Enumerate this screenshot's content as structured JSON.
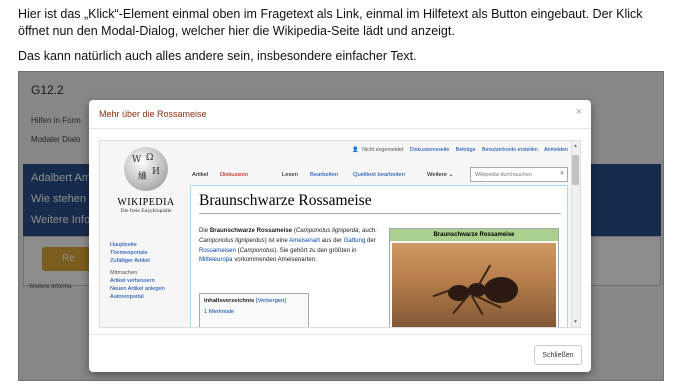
{
  "intro": {
    "line1": "Hier ist das „Klick“-Element einmal oben im Fragetext als Link, einmal im Hilfetext als Button eingebaut. Der Klick öffnet nun den Modal-Dialog, welcher hier die Wikipedia-Seite lädt und anzeigt.",
    "line2": "Das kann natürlich auch alles andere sein, insbesondere einfacher Text."
  },
  "background": {
    "question_number": "G12.2",
    "hint_line1": "Hilfen in Form",
    "hint_line2": "Modaler Dialo",
    "blue_line1": "Adalbert Am",
    "blue_line2": "Wie stehen S",
    "blue_line3": "Weitere Info",
    "button_label": "Re",
    "footer": "Weitere Informa"
  },
  "modal": {
    "title": "Mehr über die Rossameise",
    "close_symbol": "×",
    "close_button": "Schließen"
  },
  "wiki": {
    "wordmark": "WIKIPEDIA",
    "tagline": "Die freie Enzyklopädie",
    "personal": {
      "not_logged_in": "Nicht angemeldet",
      "talk": "Diskussionsseite",
      "contributions": "Beiträge",
      "create_account": "Benutzerkonto erstellen",
      "login": "Anmelden"
    },
    "tabs": {
      "article": "Artikel",
      "discussion": "Diskussion",
      "read": "Lesen",
      "edit": "Bearbeiten",
      "edit_source": "Quelltext bearbeiten",
      "more": "Weitere"
    },
    "search_placeholder": "Wikipedia durchsuchen",
    "sidebar": {
      "main_page": "Hauptseite",
      "portals": "Themenportale",
      "random": "Zufälliger Artikel",
      "participate": "Mitmachen",
      "improve": "Artikel verbessern",
      "new_article": "Neuen Artikel anlegen",
      "community_portal": "Autorenportal"
    },
    "heading": "Braunschwarze Rossameise",
    "intro_text": {
      "p1": "Die ",
      "bold_name": "Braunschwarze Rossameise",
      "p2": " (",
      "sci_name": "Camponotus ligniperda",
      "p3": ", auch: ",
      "sci_name_alt": "Camponotus ligniperdus",
      "p4": ") ist eine ",
      "link_ameisenart": "Ameisenart",
      "p5": " aus der ",
      "link_gattung": "Gattung",
      "p6": " der ",
      "link_rossameisen": "Rossameisen",
      "p7": " (",
      "genus": "Camponotus",
      "p8": "). Sie gehört zu den größten in ",
      "link_mitteleuropa": "Mitteleuropa",
      "p9": " vorkommenden Ameisenarten."
    },
    "toc": {
      "title": "Inhaltsverzeichnis",
      "hide": "[Verbergen]",
      "item1": "1  Merkmale"
    },
    "infobox_title": "Braunschwarze Rossameise"
  }
}
